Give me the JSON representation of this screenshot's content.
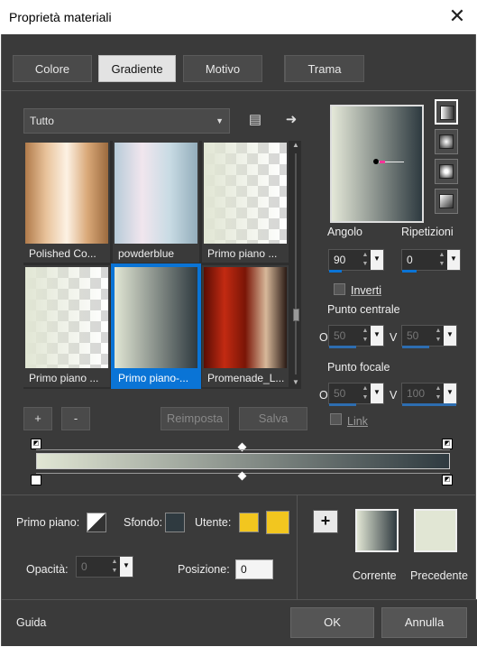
{
  "window": {
    "title": "Proprietà materiali",
    "close_icon": "close-icon"
  },
  "tabs": [
    {
      "label": "Colore",
      "active": false
    },
    {
      "label": "Gradiente",
      "active": true
    },
    {
      "label": "Motivo",
      "active": false
    },
    {
      "label": "Trama",
      "active": false
    }
  ],
  "category": {
    "value": "Tutto"
  },
  "gradients": [
    {
      "label": "Polished Co...",
      "selected": false
    },
    {
      "label": "powderblue",
      "selected": false
    },
    {
      "label": "Primo piano ...",
      "selected": false
    },
    {
      "label": "Primo piano ...",
      "selected": false
    },
    {
      "label": "Primo piano-...",
      "selected": true
    },
    {
      "label": "Promenade_L...",
      "selected": false
    }
  ],
  "gallery_buttons": {
    "add": "+",
    "remove": "-",
    "reset": "Reimposta",
    "save": "Salva"
  },
  "settings": {
    "angle_label": "Angolo",
    "angle": "90",
    "repeat_label": "Ripetizioni",
    "repeat": "0",
    "invert_label": "Inverti",
    "invert_checked": false,
    "center_label": "Punto centrale",
    "center_h_label": "O",
    "center_h": "50",
    "center_v_label": "V",
    "center_v": "50",
    "focal_label": "Punto focale",
    "focal_h_label": "O",
    "focal_h": "50",
    "focal_v_label": "V",
    "focal_v": "100",
    "link_label": "Link",
    "link_checked": false
  },
  "colors": {
    "foreground": "#e1e6d4",
    "background": "#2f3a40",
    "user": "#f2c61f"
  },
  "bottom": {
    "fg_label": "Primo piano:",
    "bg_label": "Sfondo:",
    "user_label": "Utente:",
    "opacity_label": "Opacità:",
    "opacity": "0",
    "position_label": "Posizione:",
    "position": "0",
    "current_label": "Corrente",
    "previous_label": "Precedente"
  },
  "footer": {
    "help": "Guida",
    "ok": "OK",
    "cancel": "Annulla"
  }
}
